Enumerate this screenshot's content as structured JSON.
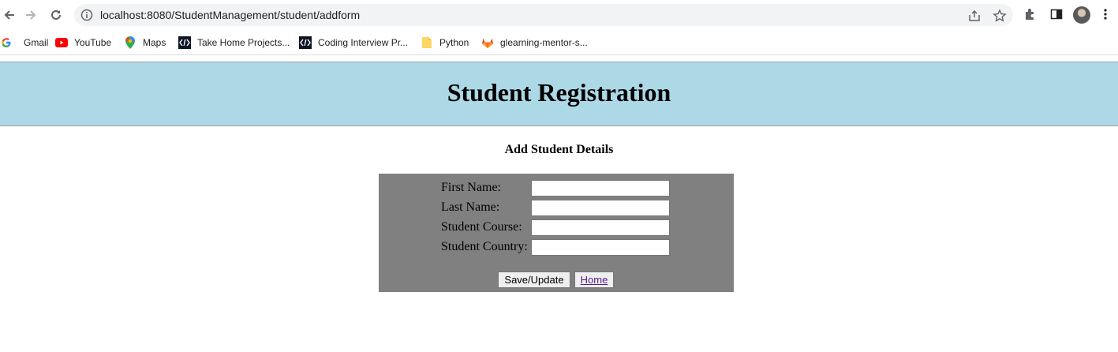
{
  "browser": {
    "url": "localhost:8080/StudentManagement/student/addform",
    "bookmarks": [
      {
        "label": "Gmail",
        "icon": "google-icon"
      },
      {
        "label": "YouTube",
        "icon": "youtube-icon"
      },
      {
        "label": "Maps",
        "icon": "maps-icon"
      },
      {
        "label": "Take Home Projects...",
        "icon": "codeium-icon"
      },
      {
        "label": "Coding Interview Pr...",
        "icon": "codeium-icon"
      },
      {
        "label": "Python",
        "icon": "folder-icon"
      },
      {
        "label": "glearning-mentor-s...",
        "icon": "gitlab-icon"
      }
    ]
  },
  "page": {
    "title": "Student Registration",
    "subtitle": "Add Student Details",
    "banner_color": "#add8e6",
    "panel_color": "#808080",
    "form": {
      "fields": [
        {
          "label": "First Name:",
          "value": ""
        },
        {
          "label": "Last Name:",
          "value": ""
        },
        {
          "label": "Student Course:",
          "value": ""
        },
        {
          "label": "Student Country:",
          "value": ""
        }
      ],
      "submit_label": "Save/Update",
      "home_link": "Home"
    }
  }
}
